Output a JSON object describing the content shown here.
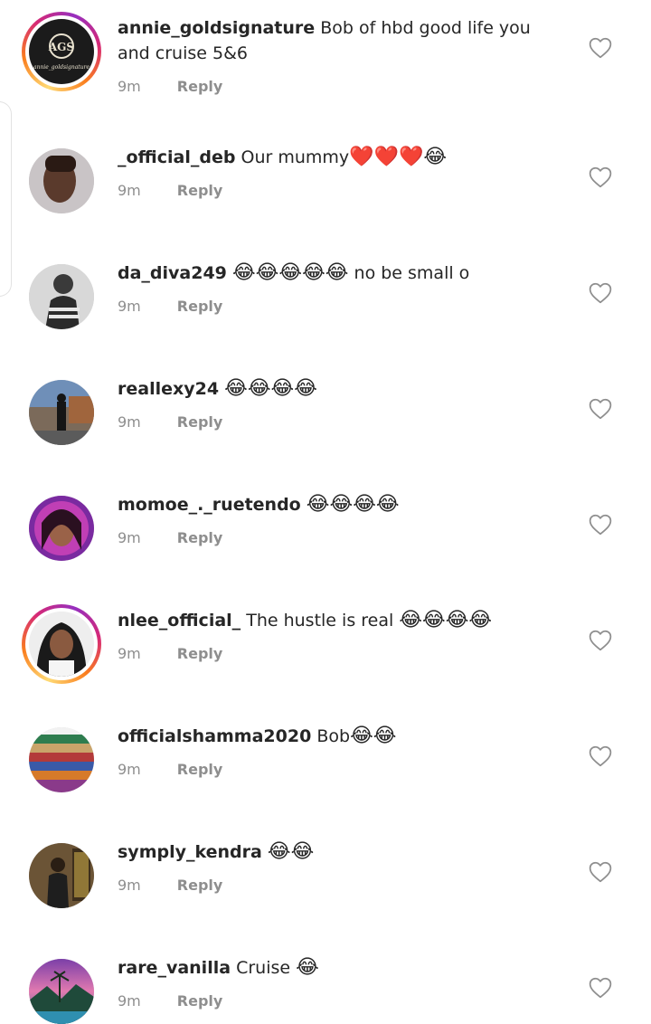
{
  "comments": [
    {
      "username": "annie_goldsignature",
      "text": "Bob of hbd good life you and cruise 5&6",
      "emoji": "",
      "time": "9m",
      "reply": "Reply",
      "story": true,
      "avatar_text": "annie_goldsignature"
    },
    {
      "username": "_official_deb",
      "text": "Our mummy",
      "emoji": "❤️❤️❤️😂",
      "time": "9m",
      "reply": "Reply",
      "story": false
    },
    {
      "username": "da_diva249",
      "text": "",
      "emoji": "😂😂😂😂😂",
      "text_after": "no be small o",
      "time": "9m",
      "reply": "Reply",
      "story": false
    },
    {
      "username": "reallexy24",
      "text": "",
      "emoji": "😂😂😂😂",
      "time": "9m",
      "reply": "Reply",
      "story": false
    },
    {
      "username": "momoe_._ruetendo",
      "text": "",
      "emoji": "😂😂😂😂",
      "time": "9m",
      "reply": "Reply",
      "story": false
    },
    {
      "username": "nlee_official_",
      "text": "The hustle is real",
      "emoji": "😂😂😂😂",
      "time": "9m",
      "reply": "Reply",
      "story": true
    },
    {
      "username": "officialshamma2020",
      "text": "Bob",
      "emoji": "😂😂",
      "time": "9m",
      "reply": "Reply",
      "story": false
    },
    {
      "username": "symply_kendra",
      "text": "",
      "emoji": "😂😂",
      "time": "9m",
      "reply": "Reply",
      "story": false
    },
    {
      "username": "rare_vanilla",
      "text": "Cruise",
      "emoji": "😂",
      "time": "9m",
      "reply": "Reply",
      "story": false
    }
  ]
}
